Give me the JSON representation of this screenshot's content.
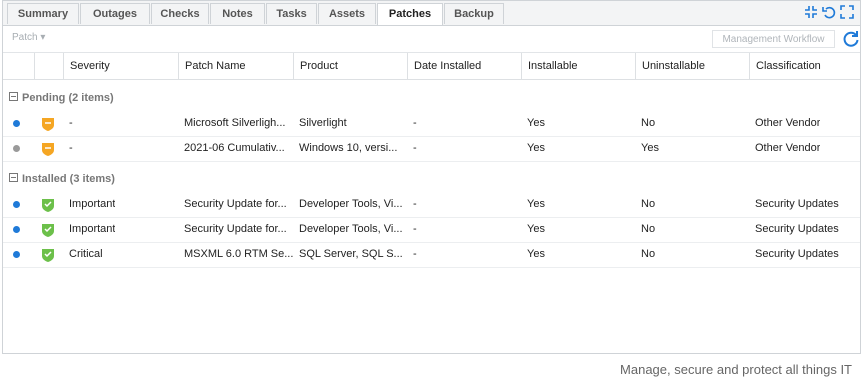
{
  "tabs": [
    {
      "label": "Summary"
    },
    {
      "label": "Outages"
    },
    {
      "label": "Checks"
    },
    {
      "label": "Notes"
    },
    {
      "label": "Tasks"
    },
    {
      "label": "Assets"
    },
    {
      "label": "Patches",
      "active": true
    },
    {
      "label": "Backup"
    }
  ],
  "toolbar": {
    "patch_dropdown": "Patch ▾",
    "management_workflow": "Management Workflow"
  },
  "columns": [
    "Severity",
    "Patch Name",
    "Product",
    "Date Installed",
    "Installable",
    "Uninstallable",
    "Classification"
  ],
  "groups": [
    {
      "label": "Pending (2 items)",
      "rows": [
        {
          "status_color": "#1f7ad8",
          "shield": "orange",
          "severity": "-",
          "patch_name": "Microsoft Silverligh...",
          "product": "Silverlight",
          "date_installed": "-",
          "installable": "Yes",
          "uninstallable": "No",
          "classification": "Other Vendor"
        },
        {
          "status_color": "#9a9a9a",
          "shield": "orange",
          "severity": "-",
          "patch_name": "2021-06 Cumulativ...",
          "product": "Windows 10, versi...",
          "date_installed": "-",
          "installable": "Yes",
          "uninstallable": "Yes",
          "classification": "Other Vendor"
        }
      ]
    },
    {
      "label": "Installed (3 items)",
      "rows": [
        {
          "status_color": "#1f7ad8",
          "shield": "green",
          "severity": "Important",
          "patch_name": "Security Update for...",
          "product": "Developer Tools, Vi...",
          "date_installed": "-",
          "installable": "Yes",
          "uninstallable": "No",
          "classification": "Security Updates"
        },
        {
          "status_color": "#1f7ad8",
          "shield": "green",
          "severity": "Important",
          "patch_name": "Security Update for...",
          "product": "Developer Tools, Vi...",
          "date_installed": "-",
          "installable": "Yes",
          "uninstallable": "No",
          "classification": "Security Updates"
        },
        {
          "status_color": "#1f7ad8",
          "shield": "green",
          "severity": "Critical",
          "patch_name": "MSXML 6.0 RTM Se...",
          "product": "SQL Server, SQL S...",
          "date_installed": "-",
          "installable": "Yes",
          "uninstallable": "No",
          "classification": "Security Updates"
        }
      ]
    }
  ],
  "colors": {
    "accent": "#1f7ad8",
    "shield_orange": "#f5a623",
    "shield_green": "#6cc04a"
  },
  "footer": "Manage, secure and protect all things IT"
}
